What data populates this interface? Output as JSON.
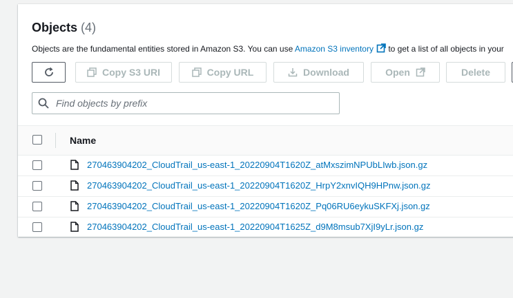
{
  "header": {
    "title": "Objects",
    "count": "(4)"
  },
  "description": {
    "text_before": "Objects are the fundamental entities stored in Amazon S3. You can use ",
    "link": "Amazon S3 inventory",
    "text_after": " to get a list of all objects in your"
  },
  "toolbar": {
    "copy_s3_uri": "Copy S3 URI",
    "copy_url": "Copy URL",
    "download": "Download",
    "open": "Open",
    "delete": "Delete"
  },
  "search": {
    "placeholder": "Find objects by prefix"
  },
  "table": {
    "header_name": "Name",
    "rows": [
      {
        "name": "270463904202_CloudTrail_us-east-1_20220904T1620Z_atMxszimNPUbLIwb.json.gz"
      },
      {
        "name": "270463904202_CloudTrail_us-east-1_20220904T1620Z_HrpY2xnvIQH9HPnw.json.gz"
      },
      {
        "name": "270463904202_CloudTrail_us-east-1_20220904T1620Z_Pq06RU6eykuSKFXj.json.gz"
      },
      {
        "name": "270463904202_CloudTrail_us-east-1_20220904T1625Z_d9M8msub7XjI9yLr.json.gz"
      }
    ]
  },
  "colors": {
    "link": "#0073bb",
    "disabled": "#aab7b8",
    "text": "#16191f"
  }
}
